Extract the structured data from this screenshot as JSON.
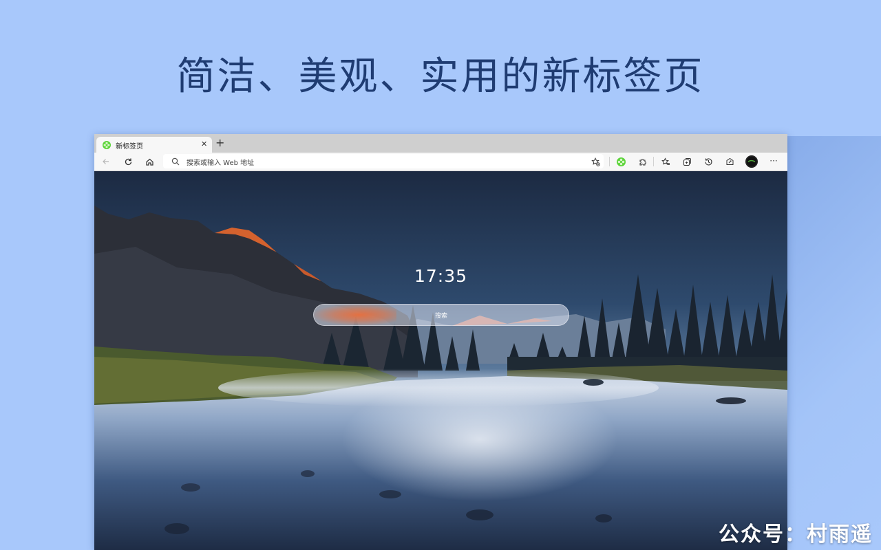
{
  "headline": "简洁、美观、实用的新标签页",
  "browser": {
    "tab": {
      "title": "新标签页",
      "close": "✕",
      "favicon": "green-flower-icon"
    },
    "new_tab": "+",
    "toolbar": {
      "back_icon": "back-arrow-icon",
      "refresh_icon": "refresh-icon",
      "home_icon": "home-icon",
      "search_icon": "search-icon",
      "address_placeholder": "搜索或输入 Web 地址",
      "favorite_add_icon": "star-add-icon",
      "extension_icons": [
        "green-flower-icon",
        "puzzle-icon"
      ],
      "right_icons": [
        "favorites-icon",
        "collections-icon",
        "history-icon",
        "performance-icon",
        "profile-avatar",
        "more-icon"
      ],
      "more": "···"
    }
  },
  "newtab_page": {
    "clock": "17:35",
    "search_placeholder": "搜索",
    "background": "mountain-lake-scenery"
  },
  "watermark": "公众号：村雨遥",
  "colors": {
    "page_background": "#a8c8fb",
    "headline": "#1f3c72",
    "accent_green": "#5cd43a",
    "search_glow": "#e86e3c"
  }
}
